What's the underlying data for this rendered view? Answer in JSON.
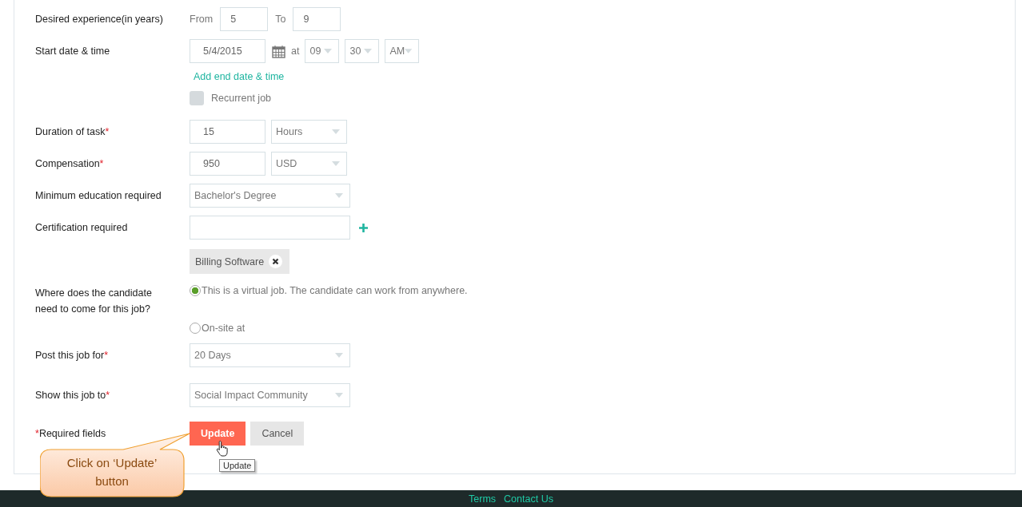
{
  "form": {
    "rows": [
      {
        "label": "Desired experience(in years)",
        "controls": [
          {
            "kind": "text",
            "text": "From"
          },
          {
            "kind": "number-input",
            "value": "5"
          },
          {
            "kind": "text",
            "text": "To"
          },
          {
            "kind": "number-input",
            "value": "9"
          }
        ]
      },
      {
        "label": "Start date & time",
        "controls": [
          {
            "kind": "input",
            "value": "5/4/2015"
          },
          {
            "kind": "calendar"
          },
          {
            "kind": "text",
            "text": "at"
          },
          {
            "kind": "short-select",
            "value": "09"
          },
          {
            "kind": "short-select",
            "value": "30"
          },
          {
            "kind": "short-select",
            "value": "AM"
          }
        ]
      },
      {
        "controls": [
          {
            "kind": "link",
            "text": "Add end date & time"
          }
        ]
      },
      {
        "controls": [
          {
            "kind": "checkbox",
            "text": "Recurrent job",
            "checked": false
          }
        ]
      },
      {
        "label": "Duration of task",
        "required_mark": "*",
        "controls": [
          {
            "kind": "input",
            "value": "15"
          },
          {
            "kind": "select",
            "value": "Hours"
          }
        ]
      },
      {
        "label": "Compensation",
        "required_mark": "*",
        "controls": [
          {
            "kind": "input",
            "value": "950"
          },
          {
            "kind": "select",
            "value": "USD"
          }
        ]
      },
      {
        "label": "Minimum education required",
        "controls": [
          {
            "kind": "wide-select",
            "value": "Bachelor's Degree"
          }
        ]
      },
      {
        "label": "Certification required",
        "controls": [
          {
            "kind": "wide-input"
          },
          {
            "kind": "add"
          }
        ]
      },
      {
        "controls": [
          {
            "kind": "tag",
            "text": "Billing Software"
          }
        ]
      },
      {
        "label": "Where does the candidate need to come for this job?",
        "controls": [
          {
            "kind": "radio",
            "text": "This is a virtual job. The candidate can work from anywhere.",
            "selected": true
          }
        ]
      },
      {
        "controls": [
          {
            "kind": "radio",
            "text": "On-site at",
            "selected": false
          }
        ]
      },
      {
        "label": "Post this job for",
        "required_mark": "*",
        "controls": [
          {
            "kind": "wide-select",
            "value": "20 Days"
          }
        ]
      },
      {
        "label": "Show this job to",
        "required_mark": "*",
        "controls": [
          {
            "kind": "wide-select",
            "value": "Social Impact Community"
          }
        ]
      },
      {
        "lead_mark": "*",
        "label": "Required fields",
        "controls": [
          {
            "kind": "primary-button",
            "text": "Update",
            "tooltip": "Update"
          },
          {
            "kind": "button",
            "text": "Cancel"
          }
        ]
      }
    ]
  },
  "callout": {
    "text": "Click on ‘Update’ button"
  },
  "footer": {
    "links": [
      "Terms",
      "Contact Us"
    ]
  }
}
